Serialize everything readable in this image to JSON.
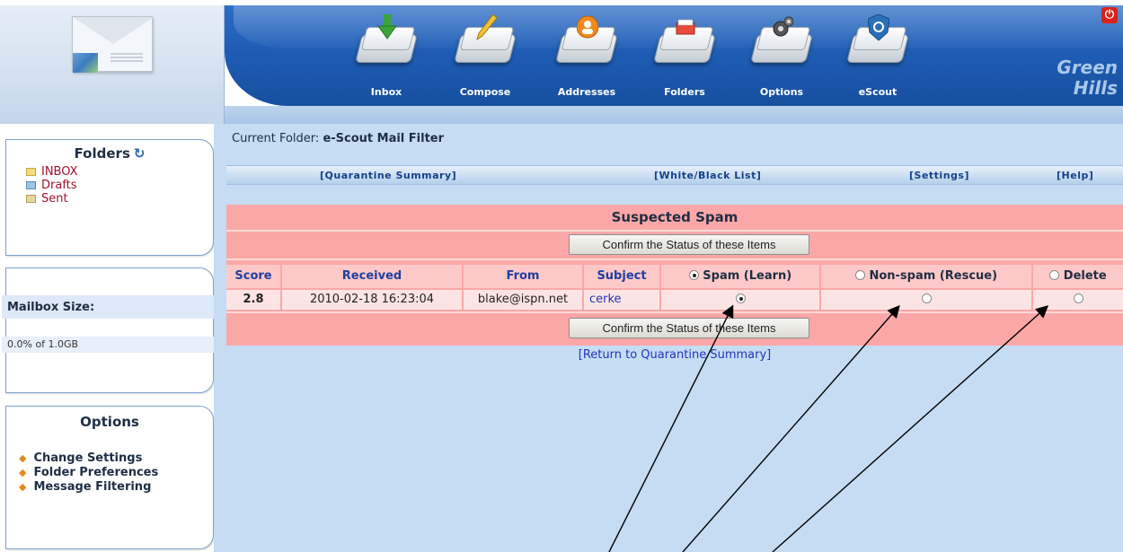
{
  "brand": {
    "line1": "Green",
    "line2": "Hills"
  },
  "nav": [
    {
      "label": "Inbox",
      "icon": "inbox-icon"
    },
    {
      "label": "Compose",
      "icon": "compose-icon"
    },
    {
      "label": "Addresses",
      "icon": "addresses-icon"
    },
    {
      "label": "Folders",
      "icon": "folders-icon"
    },
    {
      "label": "Options",
      "icon": "options-icon"
    },
    {
      "label": "eScout",
      "icon": "escout-icon"
    }
  ],
  "sidebar": {
    "folders_title": "Folders",
    "folders": [
      {
        "label": "INBOX",
        "icon": "inbox-folder-icon"
      },
      {
        "label": "Drafts",
        "icon": "drafts-folder-icon"
      },
      {
        "label": "Sent",
        "icon": "sent-folder-icon"
      }
    ],
    "mailbox_label": "Mailbox Size:",
    "mailbox_value": "0.0% of 1.0GB",
    "options_title": "Options",
    "options": [
      {
        "label": "Change Settings"
      },
      {
        "label": "Folder Preferences"
      },
      {
        "label": "Message Filtering"
      }
    ]
  },
  "main": {
    "current_folder_label": "Current Folder:",
    "current_folder_name": "e-Scout Mail Filter",
    "subnav": {
      "quarantine": "[Quarantine Summary]",
      "whiteblack": "[White/Black List]",
      "settings": "[Settings]",
      "help": "[Help]"
    },
    "spam_title": "Suspected Spam",
    "confirm_label": "Confirm the Status of these Items",
    "columns": {
      "score": "Score",
      "received": "Received",
      "from": "From",
      "subject": "Subject",
      "spam": "Spam (Learn)",
      "nonspam": "Non-spam (Rescue)",
      "delete": "Delete"
    },
    "rows": [
      {
        "score": "2.8",
        "received": "2010-02-18 16:23:04",
        "from": "blake@ispn.net",
        "subject": "cerke",
        "selected": "spam"
      }
    ],
    "return_link": "[Return to Quarantine Summary]"
  }
}
